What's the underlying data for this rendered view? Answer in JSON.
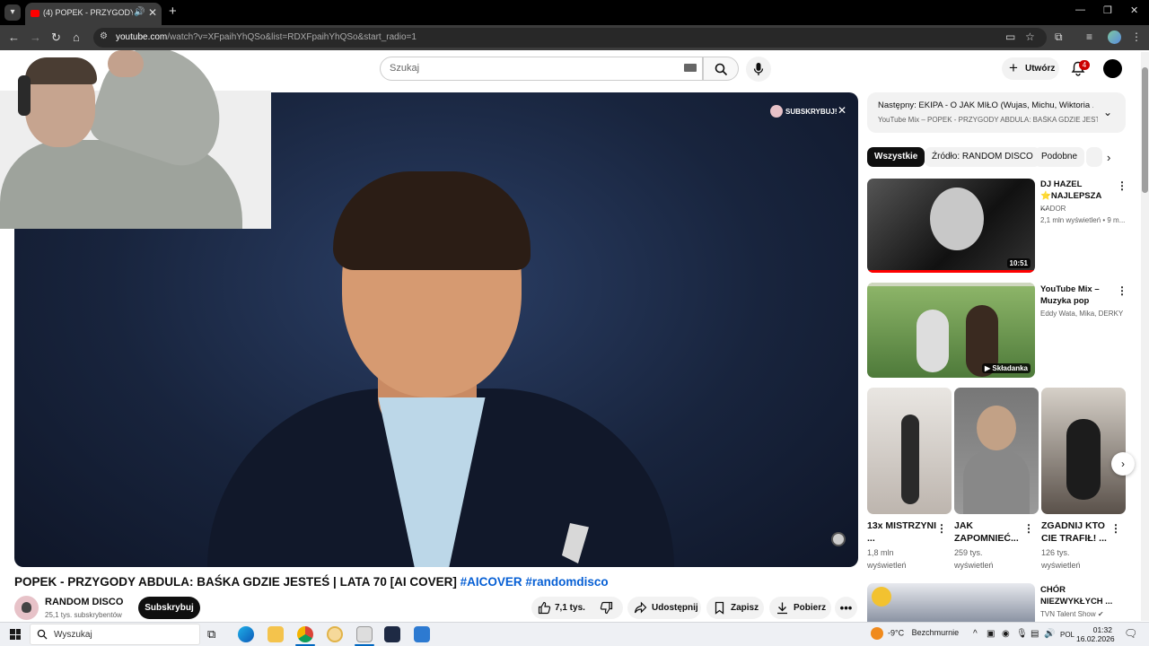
{
  "browser": {
    "tab_title": "(4) POPEK - PRZYGODY ABDULA",
    "url_host": "youtube.com",
    "url_path": "/watch?v=XFpaihYhQSo&list=RDXFpaihYhQSo&start_radio=1",
    "icons": [
      "tab-list-icon",
      "youtube-favicon",
      "speaker-icon",
      "close-icon",
      "plus-icon",
      "minimize-icon",
      "restore-icon",
      "close-window-icon",
      "back-icon",
      "forward-icon",
      "reload-icon",
      "home-icon",
      "site-info-icon",
      "install-icon",
      "star-icon",
      "extensions-icon",
      "reading-list-icon",
      "profile-icon",
      "menu-icon"
    ]
  },
  "header": {
    "search_placeholder": "Szukaj",
    "create_label": "Utwórz",
    "notification_count": "4"
  },
  "player": {
    "subscribe_overlay": "SUBSKRYBUJ!"
  },
  "video": {
    "title": "POPEK - PRZYGODY ABDULA: BAŚKA GDZIE JESTEŚ | LATA 70 [AI COVER]",
    "hashtag1": "#AICOVER",
    "hashtag2": "#randomdisco",
    "channel_name": "RANDOM DISCO",
    "channel_subs": "25,1 tys. subskrybentów",
    "subscribe_label": "Subskrybuj",
    "likes": "7,1 tys.",
    "share_label": "Udostępnij",
    "save_label": "Zapisz",
    "download_label": "Pobierz"
  },
  "sidebar": {
    "next_label": "Następny:",
    "next_title": "EKIPA - O JAK MIŁO (Wujas, Michu, Wiktoria ...",
    "mix_line": "YouTube Mix – POPEK - PRZYGODY ABDULA: BAŚKA GDZIE JEST...",
    "chips": [
      "Wszystkie",
      "Źródło: RANDOM DISCO",
      "Podobne"
    ],
    "recs": [
      {
        "title": "DJ HAZEL ⭐NAJLEPSZA ...",
        "channel": "KADOR",
        "meta": "2,1 mln wyświetleń • 9 m...",
        "duration": "10:51"
      },
      {
        "title": "YouTube Mix – Muzyka pop",
        "channel": "Eddy Wata, Mika, DERKY ...",
        "badge": "Składanka"
      }
    ],
    "shorts": [
      {
        "title": "13x MISTRZYNI ...",
        "views_1": "1,8 mln",
        "views_2": "wyświetleń"
      },
      {
        "title": "JAK ZAPOMNIEĆ...",
        "views_1": "259 tys.",
        "views_2": "wyświetleń"
      },
      {
        "title": "ZGADNIJ KTO CIE TRAFIŁ! ...",
        "views_1": "126 tys.",
        "views_2": "wyświetleń"
      }
    ],
    "rec3": {
      "title": "CHÓR NIEZWYKŁYCH ...",
      "channel": "TVN Talent Show"
    }
  },
  "taskbar": {
    "search_placeholder": "Wyszukaj",
    "weather_temp": "-9°C",
    "weather_text": "Bezchmurnie",
    "lang": "POL",
    "time": "01:32",
    "date": "16.02.2026"
  },
  "colors": {
    "accent_red": "#ff0000",
    "link_blue": "#065fd4",
    "chrome_dark": "#3c3c3c"
  }
}
